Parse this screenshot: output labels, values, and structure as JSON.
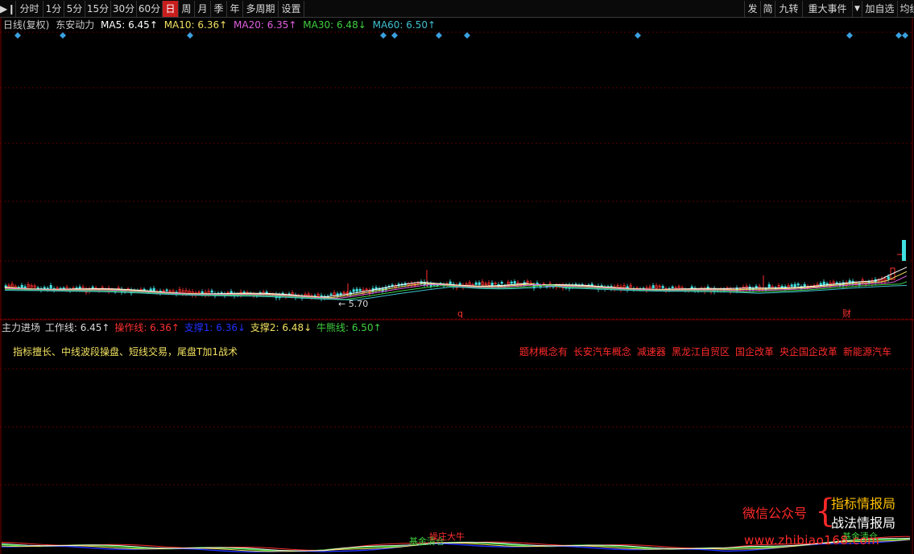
{
  "toolbar": {
    "left": [
      {
        "label": "分时",
        "name": "tab-fenshi"
      },
      {
        "label": "1分",
        "name": "tab-1min"
      },
      {
        "label": "5分",
        "name": "tab-5min"
      },
      {
        "label": "15分",
        "name": "tab-15min"
      },
      {
        "label": "30分",
        "name": "tab-30min"
      },
      {
        "label": "60分",
        "name": "tab-60min"
      },
      {
        "label": "日",
        "name": "tab-day",
        "active": true
      },
      {
        "label": "周",
        "name": "tab-week"
      },
      {
        "label": "月",
        "name": "tab-month"
      },
      {
        "label": "季",
        "name": "tab-quarter"
      },
      {
        "label": "年",
        "name": "tab-year"
      },
      {
        "label": "多周期",
        "name": "tab-multi-period"
      },
      {
        "label": "设置",
        "name": "tab-settings"
      }
    ],
    "right": [
      {
        "label": "发",
        "name": "btn-fa"
      },
      {
        "label": "简",
        "name": "btn-jian"
      },
      {
        "label": "九转",
        "name": "btn-jiuzhuan"
      },
      {
        "label": "重大事件",
        "name": "btn-major-events"
      },
      {
        "label": "加自选",
        "name": "btn-add-watchlist"
      },
      {
        "label": "均线",
        "name": "btn-ma"
      }
    ],
    "accent": "#c81e1e"
  },
  "ma_header": {
    "period": "日线(复权)",
    "stock": "东安动力",
    "ma5": "MA5: 6.45↑",
    "ma10": "MA10: 6.36↑",
    "ma20": "MA20: 6.35↑",
    "ma30": "MA30: 6.48↓",
    "ma60": "MA60: 6.50↑",
    "colors": {
      "ma5": "#ffffff",
      "ma10": "#f0e060",
      "ma20": "#e060e0",
      "ma30": "#40d040",
      "ma60": "#40c0d0"
    }
  },
  "main_chart": {
    "low_label": "5.70",
    "marker_q": "q",
    "marker_cai": "财"
  },
  "sub_header": {
    "title": "主力进场",
    "work_line": "工作线: 6.45↑",
    "op_line": "操作线: 6.36↑",
    "support1": "支撑1: 6.36↓",
    "support2": "支撑2: 6.48↓",
    "bull_line": "牛熊线: 6.50↑",
    "colors": {
      "work": "#d8d8d8",
      "op": "#ff3030",
      "s1": "#2030ff",
      "s2": "#f0e060",
      "bull": "#40d040"
    }
  },
  "sub_panel": {
    "desc": "指标擅长、中线波段操盘、短线交易，尾盘T加1战术",
    "tags": [
      "题材概念有",
      "长安汽车概念",
      "减速器",
      "黑龙江自贸区",
      "国企改革",
      "央企国企改革",
      "新能源汽车"
    ],
    "bottom_label1": "基金清仓",
    "bottom_label2": "操庄大牛",
    "bottom_label3": "基金清仓"
  },
  "watermark": {
    "left": "微信公众号",
    "right1": "指标情报局",
    "right2": "战法情报局",
    "url": "www.zhibiao168.com"
  }
}
